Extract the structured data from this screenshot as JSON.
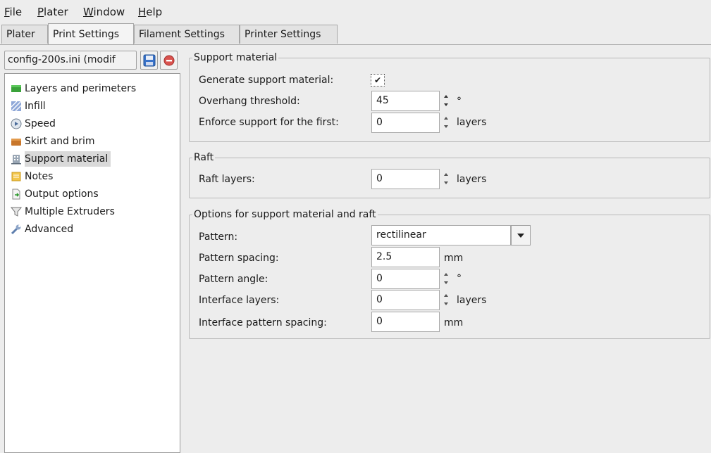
{
  "menubar": {
    "items": [
      {
        "label": "File",
        "accel": "F",
        "rest": "ile"
      },
      {
        "label": "Plater",
        "accel": "P",
        "rest": "later"
      },
      {
        "label": "Window",
        "accel": "W",
        "rest": "indow"
      },
      {
        "label": "Help",
        "accel": "H",
        "rest": "elp"
      }
    ]
  },
  "tabs": [
    "Plater",
    "Print Settings",
    "Filament Settings",
    "Printer Settings"
  ],
  "active_tab": "Print Settings",
  "preset": {
    "value": "config-200s.ini (modif"
  },
  "tree": {
    "items": [
      {
        "label": "Layers and perimeters",
        "icon": "layers-icon"
      },
      {
        "label": "Infill",
        "icon": "infill-icon"
      },
      {
        "label": "Speed",
        "icon": "speed-icon"
      },
      {
        "label": "Skirt and brim",
        "icon": "skirt-brim-icon"
      },
      {
        "label": "Support material",
        "icon": "support-icon",
        "selected": true
      },
      {
        "label": "Notes",
        "icon": "notes-icon"
      },
      {
        "label": "Output options",
        "icon": "output-icon"
      },
      {
        "label": "Multiple Extruders",
        "icon": "funnel-icon"
      },
      {
        "label": "Advanced",
        "icon": "wrench-icon"
      }
    ]
  },
  "support": {
    "title": "Support material",
    "generate_label": "Generate support material:",
    "generate_checked": true,
    "generate_mark": "✔",
    "overhang_label": "Overhang threshold:",
    "overhang_value": "45",
    "overhang_unit": "°",
    "enforce_label": "Enforce support for the first:",
    "enforce_value": "0",
    "enforce_unit": "layers"
  },
  "raft": {
    "title": "Raft",
    "layers_label": "Raft layers:",
    "layers_value": "0",
    "layers_unit": "layers"
  },
  "options": {
    "title": "Options for support material and raft",
    "pattern_label": "Pattern:",
    "pattern_value": "rectilinear",
    "spacing_label": "Pattern spacing:",
    "spacing_value": "2.5",
    "spacing_unit": "mm",
    "angle_label": "Pattern angle:",
    "angle_value": "0",
    "angle_unit": "°",
    "interface_layers_label": "Interface layers:",
    "interface_layers_value": "0",
    "interface_layers_unit": "layers",
    "interface_spacing_label": "Interface pattern spacing:",
    "interface_spacing_value": "0",
    "interface_spacing_unit": "mm"
  }
}
